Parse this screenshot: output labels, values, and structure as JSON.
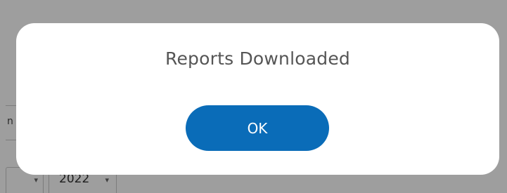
{
  "background": {
    "partial_field_text": "n",
    "year_select_value": "2022",
    "caret_glyph": "▾"
  },
  "dialog": {
    "title": "Reports Downloaded",
    "ok_label": "OK"
  },
  "colors": {
    "button_blue": "#0a6cb8",
    "title_gray": "#555555",
    "overlay": "rgba(0,0,0,0.38)"
  }
}
